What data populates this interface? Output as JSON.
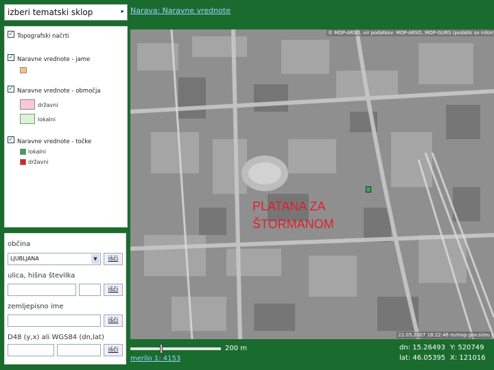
{
  "theme_select": {
    "label": "izberi tematski sklop",
    "arrow": "▸"
  },
  "breadcrumb": "Narava: Naravne vrednote",
  "legend": {
    "layers": [
      {
        "label": "Topografski načrti",
        "checked": true
      },
      {
        "label": "Naravne vrednote - jame",
        "checked": true
      },
      {
        "label": "Naravne vrednote - območja",
        "checked": true
      },
      {
        "label": "Naravne vrednote - točke",
        "checked": true
      }
    ],
    "swatches": {
      "jame": {
        "color": "#f6c08a"
      },
      "obmocja": [
        {
          "label": "državni",
          "color": "#f8c9d6"
        },
        {
          "label": "lokalni",
          "color": "#d9f5d4"
        }
      ],
      "tocke": [
        {
          "label": "lokalni",
          "color": "#3da35a"
        },
        {
          "label": "državni",
          "color": "#e02020"
        }
      ]
    }
  },
  "search": {
    "obcina": {
      "label": "občina",
      "value": "LJUBLJANA",
      "button": "išči"
    },
    "ulica": {
      "label": "ulica, hišna številka",
      "button": "išči"
    },
    "zemljepisno": {
      "label": "zemljepisno ime",
      "button": "išči"
    },
    "koordinate": {
      "label": "D48 (y,x) ali WGS84 (dn,lat)",
      "button": "išči"
    }
  },
  "map": {
    "copyright": "© MOP-ARSO, vir podatkov: MOP-ARSO, MOP-GURS (podatki so informativni)",
    "label_line1": "PLATANA ZA",
    "label_line2": "ŠTORMANOM",
    "datestamp": "22.05.2007 18:22:46 eumap.gov.si/eu"
  },
  "scale": {
    "distance": "200 m",
    "text": "merilo 1: 4153"
  },
  "coordinates": {
    "dn": "dn: 15.26493",
    "y": "Y: 520749",
    "lat": "lat: 46.05395",
    "x": "X: 121016"
  }
}
